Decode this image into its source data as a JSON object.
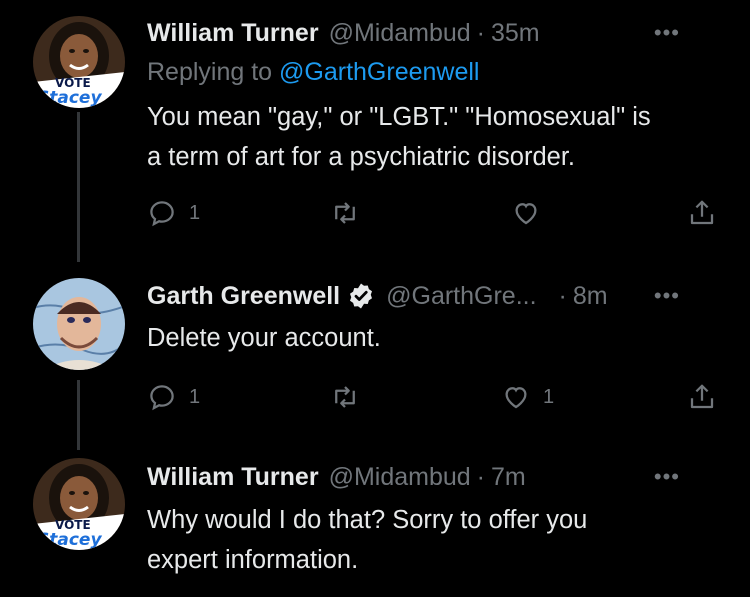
{
  "tweets": [
    {
      "author_name": "William Turner",
      "handle": "@Midambud",
      "separator": "·",
      "time": "35m",
      "replying_prefix": "Replying to",
      "replying_to": "@GarthGreenwell",
      "text_lines": [
        "You mean \"gay,\" or \"LGBT.\" \"Homosexual\" is",
        "a term of art for a psychiatric disorder."
      ],
      "reply_count": "1",
      "retweet_count": "",
      "like_count": "",
      "more_label": "•••",
      "avatar_badge_top": "VOTE",
      "avatar_badge_bottom": "Stacey"
    },
    {
      "author_name": "Garth Greenwell",
      "verified": true,
      "handle": "@GarthGre...",
      "separator": "·",
      "time": "8m",
      "text_lines": [
        "Delete your account."
      ],
      "reply_count": "1",
      "retweet_count": "",
      "like_count": "1",
      "more_label": "•••"
    },
    {
      "author_name": "William Turner",
      "handle": "@Midambud",
      "separator": "·",
      "time": "7m",
      "text_lines": [
        "Why would I do that? Sorry to offer you",
        "expert information."
      ],
      "more_label": "•••",
      "avatar_badge_top": "VOTE",
      "avatar_badge_bottom": "Stacey"
    }
  ],
  "colors": {
    "background": "#000000",
    "text_primary": "#e7e9ea",
    "text_secondary": "#71767b",
    "link": "#1d9bf0",
    "thread_line": "#333639"
  },
  "icons": [
    "reply-icon",
    "retweet-icon",
    "like-icon",
    "share-icon",
    "more-icon",
    "verified-badge-icon"
  ]
}
